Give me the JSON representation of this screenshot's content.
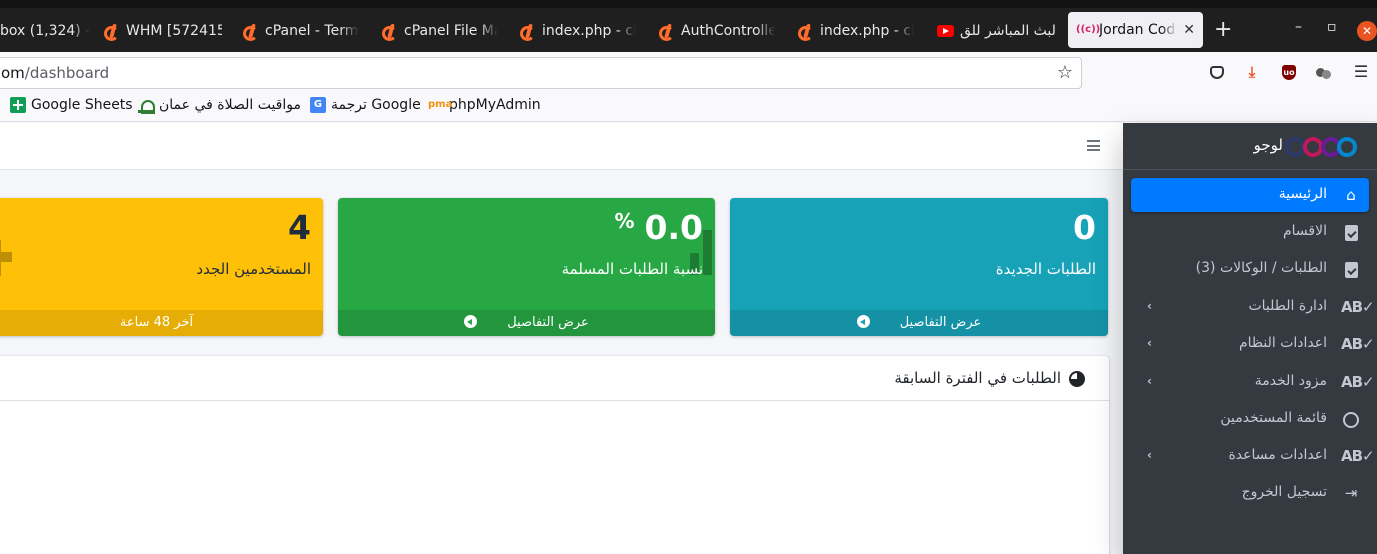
{
  "browser": {
    "tabs": [
      {
        "label": "box (1,324) -",
        "icon": ""
      },
      {
        "label": "WHM [572415",
        "icon": "cpanel-icon"
      },
      {
        "label": "cPanel - Termi",
        "icon": "cpanel-icon"
      },
      {
        "label": "cPanel File Ma",
        "icon": "cpanel-icon"
      },
      {
        "label": "index.php - cP",
        "icon": "cpanel-icon"
      },
      {
        "label": "AuthControlle",
        "icon": "cpanel-icon"
      },
      {
        "label": "index.php - cP",
        "icon": "cpanel-icon"
      },
      {
        "label": "البث المباشر للق",
        "icon": "youtube-icon"
      },
      {
        "label": "Jordan Code",
        "icon": "jordan-code-icon",
        "active": true
      }
    ],
    "new_tab": "+",
    "window_controls": {
      "minimize": "–",
      "maximize": "▫",
      "close": "✕"
    },
    "url": {
      "host_fragment": "om",
      "path": "/dashboard"
    },
    "bookmarks": [
      {
        "label": "Google Sheets",
        "icon": "google-sheets-icon"
      },
      {
        "label": "مواقيت الصلاة في عمان",
        "icon": "mosque-icon"
      },
      {
        "label": "ترجمة Google",
        "icon": "google-translate-icon"
      },
      {
        "label": "phpMyAdmin",
        "icon": "phpmyadmin-icon"
      }
    ]
  },
  "sidebar": {
    "brand": "لوجو",
    "items": [
      {
        "label": "الرئيسية",
        "icon": "home-icon",
        "active": true,
        "submenu": false
      },
      {
        "label": "الاقسام",
        "icon": "clipboard-check-icon",
        "submenu": false
      },
      {
        "label": "الطلبات / الوكالات (3)",
        "icon": "clipboard-check-icon",
        "submenu": false
      },
      {
        "label": "ادارة الطلبات",
        "icon": "spell-check-icon",
        "submenu": true
      },
      {
        "label": "اعدادات النظام",
        "icon": "spell-check-icon",
        "submenu": true
      },
      {
        "label": "مزود الخدمة",
        "icon": "spell-check-icon",
        "submenu": true
      },
      {
        "label": "قائمة المستخدمين",
        "icon": "circle-icon",
        "submenu": false
      },
      {
        "label": "اعدادات مساعدة",
        "icon": "spell-check-icon",
        "submenu": true
      },
      {
        "label": "تسجيل الخروج",
        "icon": "sign-out-icon",
        "submenu": false
      }
    ]
  },
  "stats": {
    "new_orders": {
      "value": "0",
      "label": "الطلبات الجديدة",
      "footer": "عرض التفاصيل",
      "color": "#17a2b8",
      "icon": "shopping-bag-icon"
    },
    "delivered_ratio": {
      "value": "0.0",
      "unit": "%",
      "label": "نسبة الطلبات المسلمة",
      "footer": "عرض التفاصيل",
      "color": "#28a745",
      "icon": "bar-chart-icon"
    },
    "new_users": {
      "value": "4",
      "label": "المستخدمين الجدد",
      "footer": "آخر 48 ساعة",
      "color": "#ffc107",
      "icon": "user-plus-icon"
    }
  },
  "chart_card": {
    "title": "الطلبات في الفترة السابقة",
    "icon": "pie-chart-icon"
  }
}
